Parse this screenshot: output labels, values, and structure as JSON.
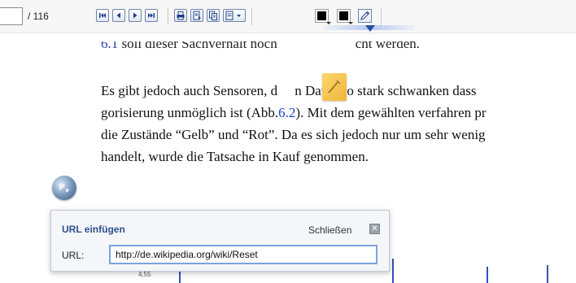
{
  "toolbar": {
    "page_input_value": "",
    "page_total": "/ 116",
    "nav_buttons": [
      "first-page-icon",
      "previous-page-icon",
      "next-page-icon",
      "last-page-icon"
    ],
    "tool_buttons": [
      "print-icon",
      "export-icon",
      "copy-icon",
      "page-menu-icon"
    ],
    "colors": {
      "text_color": "#000000",
      "highlight_color": "#000000"
    }
  },
  "document": {
    "cut_line": {
      "prefix": "6.1",
      "rest": " soll dieser Sachverhalt noch",
      "tail": "cht werden."
    },
    "paragraph": [
      {
        "before": "Es gibt jedoch auch Sensoren, d",
        "after": "n Daten so stark schwanken dass"
      },
      {
        "before": "gorisierung unmöglich ist (Abb.",
        "ref": "6.2",
        "after": "). Mit dem gewählten verfahren pr"
      },
      {
        "text": "die Zustände “Gelb” und “Rot”. Da es sich jedoch nur um sehr wenig"
      },
      {
        "text": "handelt, wurde die Tatsache in Kauf genommen."
      }
    ],
    "chart_stub_label": "4,55"
  },
  "dialog": {
    "title": "URL einfügen",
    "close_label": "Schließen",
    "close_icon": "✕",
    "url_label": "URL:",
    "url_value": "http://de.wikipedia.org/wiki/Reset"
  }
}
